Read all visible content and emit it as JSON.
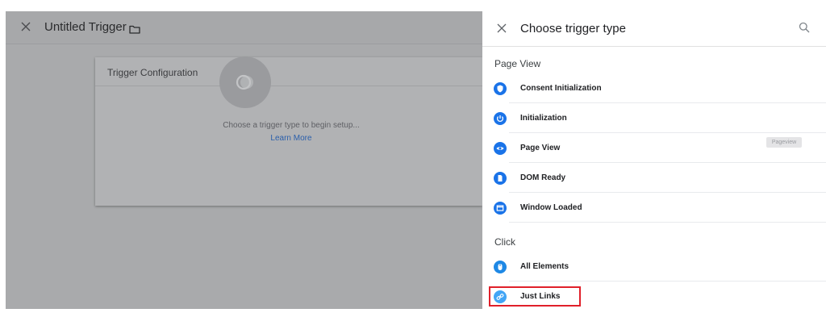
{
  "editor": {
    "title": "Untitled Trigger",
    "config_card": {
      "title": "Trigger Configuration",
      "hint": "Choose a trigger type to begin setup...",
      "learn_more": "Learn More"
    }
  },
  "panel": {
    "title": "Choose trigger type",
    "sections": [
      {
        "label": "Page View",
        "items": [
          {
            "label": "Consent Initialization",
            "icon": "shield-icon",
            "color": "#1a73e8"
          },
          {
            "label": "Initialization",
            "icon": "power-icon",
            "color": "#1a73e8"
          },
          {
            "label": "Page View",
            "icon": "eye-icon",
            "color": "#1a73e8",
            "badge": "Pageview"
          },
          {
            "label": "DOM Ready",
            "icon": "document-icon",
            "color": "#1a73e8"
          },
          {
            "label": "Window Loaded",
            "icon": "window-icon",
            "color": "#1a73e8"
          }
        ]
      },
      {
        "label": "Click",
        "items": [
          {
            "label": "All Elements",
            "icon": "cursor-icon",
            "color": "#1e88e5"
          },
          {
            "label": "Just Links",
            "icon": "link-icon",
            "color": "#1e88e5"
          }
        ]
      }
    ],
    "highlight_color": "#e0202a"
  }
}
